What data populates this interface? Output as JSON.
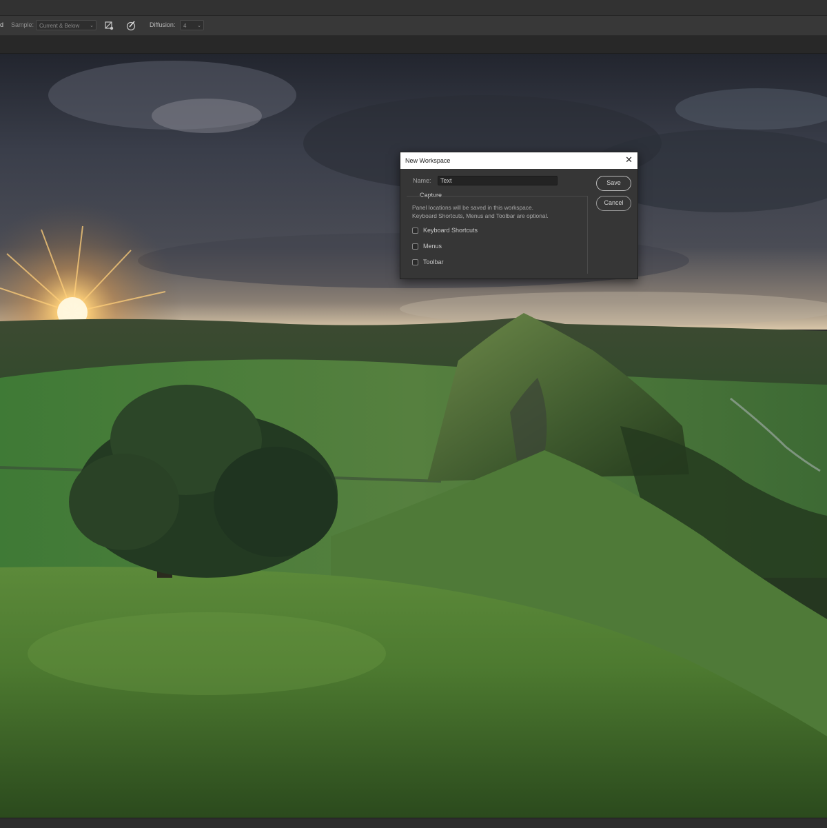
{
  "options_bar": {
    "partial_label": "d",
    "sample_label": "Sample:",
    "sample_value": "Current & Below",
    "diffusion_label": "Diffusion:",
    "diffusion_value": "4",
    "icons": [
      "ignore-adjustment-layers-icon",
      "brush-pressure-icon"
    ]
  },
  "dialog": {
    "title": "New Workspace",
    "name_label": "Name:",
    "name_value": "Text",
    "capture_label": "Capture",
    "description_line1": "Panel locations will be saved in this workspace.",
    "description_line2": "Keyboard Shortcuts, Menus and Toolbar are optional.",
    "options": [
      {
        "label": "Keyboard Shortcuts",
        "checked": false
      },
      {
        "label": "Menus",
        "checked": false
      },
      {
        "label": "Toolbar",
        "checked": false
      }
    ],
    "save_label": "Save",
    "cancel_label": "Cancel",
    "close_icon": "close-icon"
  }
}
